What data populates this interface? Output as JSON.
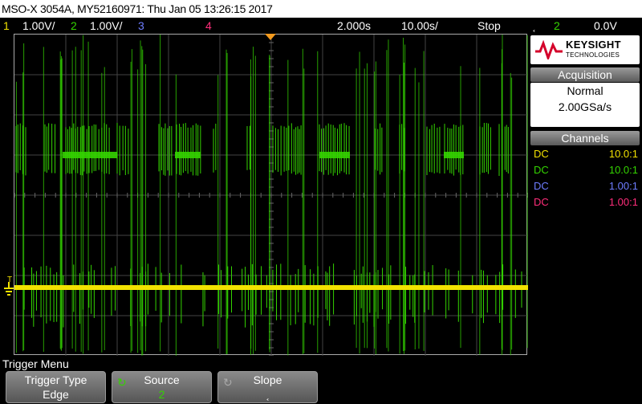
{
  "title": "MSO-X 3054A, MY52160971: Thu Jan 05 13:26:15 2017",
  "status": {
    "ch1_num": "1",
    "ch1_scale": "1.00V/",
    "ch2_num": "2",
    "ch2_scale": "1.00V/",
    "ch3_num": "3",
    "ch4_num": "4",
    "timebase": "2.000s",
    "sample": "10.00s/",
    "run_state": "Stop",
    "trig_icon": "rising-edge-icon",
    "trig_src": "2",
    "trig_level": "0.0V"
  },
  "logo": {
    "brand": "KEYSIGHT",
    "sub": "TECHNOLOGIES"
  },
  "acquisition": {
    "header": "Acquisition",
    "mode": "Normal",
    "rate": "2.00GSa/s"
  },
  "channels": {
    "header": "Channels",
    "rows": [
      {
        "coupling": "DC",
        "ratio": "10.0:1",
        "color": "#f2e200"
      },
      {
        "coupling": "DC",
        "ratio": "10.0:1",
        "color": "#34d400"
      },
      {
        "coupling": "DC",
        "ratio": "1.00:1",
        "color": "#6e7dff"
      },
      {
        "coupling": "DC",
        "ratio": "1.00:1",
        "color": "#ff2d7a"
      }
    ]
  },
  "menu": {
    "title": "Trigger Menu",
    "softkeys": [
      {
        "label": "Trigger Type",
        "value": "Edge"
      },
      {
        "label": "Source",
        "value": "2"
      },
      {
        "label": "Slope",
        "value": ""
      }
    ]
  },
  "colors": {
    "ch1": "#f2e200",
    "ch2": "#34d400",
    "ch3": "#6e7dff",
    "ch4": "#ff2d7a",
    "trigger_marker": "#f39a1e"
  }
}
